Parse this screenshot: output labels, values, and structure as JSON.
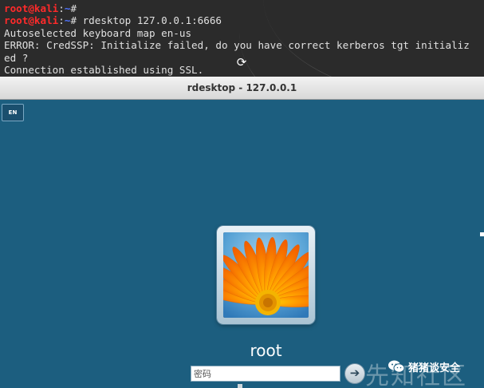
{
  "terminal": {
    "lines": [
      {
        "user": "root@kali",
        "colon": ":",
        "path": "~",
        "rest": "#"
      },
      {
        "user": "root@kali",
        "colon": ":",
        "path": "~",
        "rest": "# rdesktop 127.0.0.1:6666"
      }
    ],
    "output": [
      "Autoselected keyboard map en-us",
      "ERROR: CredSSP: Initialize failed, do you have correct kerberos tgt initializ",
      "ed ?",
      "Connection established using SSL."
    ]
  },
  "window": {
    "title": "rdesktop - 127.0.0.1"
  },
  "login": {
    "language": "EN",
    "username": "root",
    "password_placeholder": "密码",
    "submit_icon": "arrow-right-icon"
  },
  "watermark": {
    "big_text": "先知社区",
    "badge_text": "猪猪谈安全",
    "icon": "wechat-icon"
  },
  "colors": {
    "terminal_bg": "#2b2b2b",
    "prompt_user": "#ff2a2a",
    "prompt_path": "#4f74ff",
    "desktop_bg": "#1c5e7f"
  }
}
